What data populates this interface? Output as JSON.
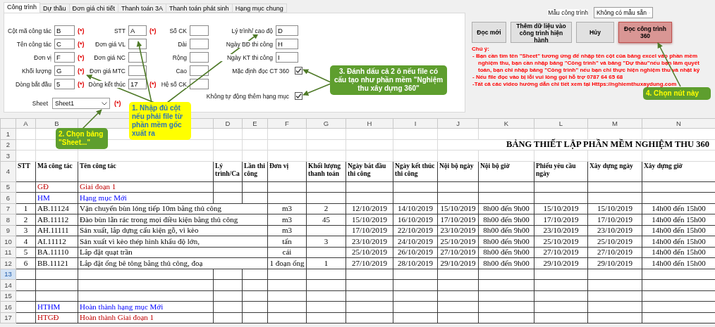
{
  "tabs": [
    {
      "label": "Công trình",
      "selected": true
    },
    {
      "label": "Dự thầu",
      "selected": false
    },
    {
      "label": "Đơn giá chi tiết",
      "selected": false
    },
    {
      "label": "Thanh toán 3A",
      "selected": false
    },
    {
      "label": "Thanh toán phát sinh",
      "selected": false
    },
    {
      "label": "Hạng mục chung",
      "selected": false
    }
  ],
  "form": {
    "columns": [
      [
        {
          "kind": "field",
          "label": "Cột mã công tác",
          "value": "B",
          "marker": "(*)"
        },
        {
          "kind": "field",
          "label": "Tên công tác",
          "value": "C",
          "marker": "(*)"
        },
        {
          "kind": "field",
          "label": "Đơn vị",
          "value": "F",
          "marker": "(*)"
        },
        {
          "kind": "field",
          "label": "Khối lượng",
          "value": "G",
          "marker": "(*)"
        },
        {
          "kind": "field",
          "label": "Dòng bắt đầu",
          "value": "5",
          "marker": "(*)"
        }
      ],
      [
        {
          "kind": "field",
          "label": "STT",
          "value": "A",
          "marker": "(*)"
        },
        {
          "kind": "field",
          "label": "Đơn giá VL"
        },
        {
          "kind": "field",
          "label": "Đơn giá NC"
        },
        {
          "kind": "field",
          "label": "Đơn giá MTC"
        },
        {
          "kind": "field",
          "label": "Dòng kết thúc",
          "value": "17",
          "marker": "(*)"
        }
      ],
      [
        {
          "kind": "field",
          "label": "Số CK"
        },
        {
          "kind": "field",
          "label": "Dài"
        },
        {
          "kind": "field",
          "label": "Rộng"
        },
        {
          "kind": "field",
          "label": "Cao"
        },
        {
          "kind": "field",
          "label": "Hệ số CK"
        }
      ],
      [
        {
          "kind": "field",
          "label": "Lý trình/ cao độ",
          "value": "D"
        },
        {
          "kind": "field",
          "label": "Ngày BĐ thi công",
          "value": "H"
        },
        {
          "kind": "field",
          "label": "Ngày KT thi công",
          "value": "I"
        },
        {
          "kind": "checkbox",
          "label": "Mặc định đọc CT 360",
          "checked": true
        }
      ]
    ],
    "auto_add_option": {
      "label": "Không tự động thêm hạng mục",
      "checked": true
    },
    "sheet": {
      "label": "Sheet",
      "value": "Sheet1",
      "marker": "(*)"
    }
  },
  "template": {
    "label": "Mẫu công trình",
    "value": "Không có mẫu sẵn"
  },
  "buttons": [
    {
      "label": "Đọc mới",
      "highlighted": false
    },
    {
      "label": "Thêm dữ liệu vào công trình hiện hành",
      "highlighted": false
    },
    {
      "label": "Hủy",
      "highlighted": false
    },
    {
      "label": "Đọc công trình 360",
      "highlighted": true
    }
  ],
  "note": {
    "title": "Chú ý:",
    "lines": [
      "- Bạn cần tìm tên \"Sheet\" tương ứng để nhập tên cột của bảng excel vào phần mềm nghiệm thu, bạn cần nhập bảng \"Công trình\" và bảng \"Dự thầu\"nếu bạn làm quyết toán, bạn chỉ nhập bảng \"Công trình\" nếu bạn chỉ thực hiện nghiệm thu và nhật ký",
      "- Nếu file đọc vào bị lỗi vui lòng gọi hỗ trợ 0787 64 65 68",
      "-Tất cả các video hướng dẫn chi tiết xem tại Https://nghiemthuxaydung.com"
    ]
  },
  "sheet": {
    "column_letters": [
      {
        "label": "A"
      },
      {
        "label": "B"
      },
      {
        "label": "D"
      },
      {
        "label": "E"
      },
      {
        "label": "F"
      },
      {
        "label": "G"
      },
      {
        "label": "H"
      },
      {
        "label": "I"
      },
      {
        "label": "J"
      },
      {
        "label": "K"
      },
      {
        "label": "L"
      },
      {
        "label": "M"
      },
      {
        "label": "N"
      }
    ],
    "row_numbers": [
      {
        "label": "1",
        "selected": false
      },
      {
        "label": "2",
        "selected": false
      },
      {
        "label": "3",
        "selected": false
      },
      {
        "label": "4",
        "selected": false
      },
      {
        "label": "5",
        "selected": false
      },
      {
        "label": "6",
        "selected": false
      },
      {
        "label": "7",
        "selected": false
      },
      {
        "label": "8",
        "selected": false
      },
      {
        "label": "9",
        "selected": false
      },
      {
        "label": "10",
        "selected": false
      },
      {
        "label": "11",
        "selected": false
      },
      {
        "label": "12",
        "selected": false
      },
      {
        "label": "13",
        "selected": true
      },
      {
        "label": "14",
        "selected": false
      },
      {
        "label": "15",
        "selected": false
      },
      {
        "label": "16",
        "selected": false
      },
      {
        "label": "17",
        "selected": false
      }
    ],
    "title": "BẢNG THIẾT LẬP PHẦN MỀM NGHIỆM THU 360",
    "headers": [
      "STT",
      "Mã công tác",
      "Tên công tác",
      "Lý trình/Ca",
      "Lần thi công",
      "Đơn vị",
      "Khối lượng thanh toán",
      "Ngày bắt đầu thi công",
      "Ngày kết thúc thi công",
      "Nội bộ ngày",
      "Nội bộ giờ",
      "Phiếu yêu cầu ngày",
      "Xây dựng ngày",
      "Xây dựng giờ"
    ],
    "rows": [
      {
        "kind": "phase",
        "code": "GĐ",
        "name": "Giai đoạn 1"
      },
      {
        "kind": "section",
        "code": "HM",
        "name": "Hạng mục Mới"
      },
      {
        "kind": "item",
        "stt": "1",
        "code": "AB.11124",
        "name": "Vận chuyển bùn lỏng tiếp 10m bằng thủ công",
        "unit": "m3",
        "quantity": "2",
        "values": [
          "12/10/2019",
          "14/10/2019",
          "15/10/2019",
          "8h00 đến 9h00",
          "15/10/2019",
          "15/10/2019",
          "14h00 đến 15h00"
        ]
      },
      {
        "kind": "item",
        "stt": "2",
        "code": "AB.11112",
        "name": "Đào bùn lẫn rác trong mọi điều kiện bằng thủ công",
        "unit": "m3",
        "quantity": "45",
        "values": [
          "15/10/2019",
          "16/10/2019",
          "17/10/2019",
          "8h00 đến 9h00",
          "17/10/2019",
          "17/10/2019",
          "14h00 đến 15h00"
        ]
      },
      {
        "kind": "item",
        "stt": "3",
        "code": "AH.11111",
        "name": "Sản xuất, lắp dựng cấu kiện gỗ, vì kèo",
        "unit": "m3",
        "values": [
          "17/10/2019",
          "22/10/2019",
          "23/10/2019",
          "8h00 đến 9h00",
          "23/10/2019",
          "23/10/2019",
          "14h00 đến 15h00"
        ]
      },
      {
        "kind": "item",
        "stt": "4",
        "code": "AI.11112",
        "name": "Sản xuất vì kèo thép hình khẩu độ lớn,",
        "unit": "tấn",
        "quantity": "3",
        "values": [
          "23/10/2019",
          "24/10/2019",
          "25/10/2019",
          "8h00 đến 9h00",
          "25/10/2019",
          "25/10/2019",
          "14h00 đến 15h00"
        ]
      },
      {
        "kind": "item",
        "stt": "5",
        "code": "BA.11110",
        "name": "Lắp đặt quạt trần",
        "unit": "cái",
        "values": [
          "25/10/2019",
          "26/10/2019",
          "27/10/2019",
          "8h00 đến 9h00",
          "27/10/2019",
          "27/10/2019",
          "14h00 đến 15h00"
        ]
      },
      {
        "kind": "item",
        "stt": "6",
        "code": "BB.11121",
        "name": "Lắp đặt ống bê tông bằng thủ công, đoạ",
        "unit": "1 đoạn ống",
        "quantity": "1",
        "values": [
          "27/10/2019",
          "28/10/2019",
          "29/10/2019",
          "8h00 đến 9h00",
          "29/10/2019",
          "29/10/2019",
          "14h00 đến 15h00"
        ]
      },
      {
        "kind": "empty"
      },
      {
        "kind": "empty"
      },
      {
        "kind": "empty"
      },
      {
        "kind": "section",
        "code": "HTHM",
        "name": "Hoàn thành hạng mục Mới"
      },
      {
        "kind": "phase",
        "code": "HTGĐ",
        "name": "Hoàn thành Giai đoạn 1"
      }
    ]
  },
  "callouts": [
    {
      "text": "1. Nhập đủ cột nếu phải file từ phần mềm gốc xuất ra",
      "color": "#ffff00"
    },
    {
      "text": "2. Chọn bảng \"Sheet...\"",
      "color": "#5e9e2e"
    },
    {
      "text": "3. Đánh dấu cả 2 ô nếu file có cấu tạo như phần mềm \"Nghiệm thu xây dựng 360\"",
      "color": "#5e9e2e"
    },
    {
      "text": "4. Chọn nút này",
      "color": "#5e9e2e"
    }
  ]
}
